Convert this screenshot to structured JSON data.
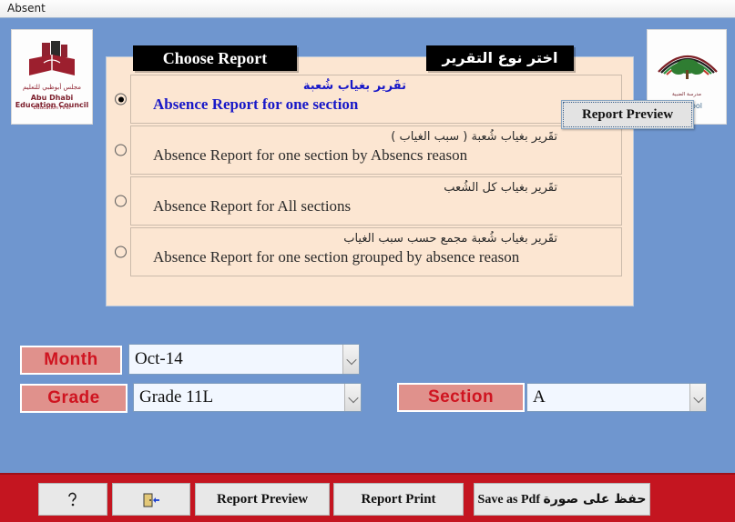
{
  "window": {
    "title": "Absent"
  },
  "theme": {
    "background": "#6f96cf",
    "panel": "#fce6d2",
    "toolbar": "#c41520",
    "label_bg": "#e0918c",
    "label_text": "#cf1420",
    "selected_option": "#1818c8"
  },
  "logos": {
    "left": {
      "name": "adec-logo",
      "line_ar": "مجلس أبوظبي للتعليم",
      "line_en": "Abu Dhabi Education Council",
      "tagline_en": "Education First",
      "tagline_ar": "التعليم أولاً"
    },
    "right": {
      "name": "school-logo",
      "line_ar": "مدرسة الضبية",
      "line_en": "a School"
    }
  },
  "report_panel": {
    "banner_en": "Choose Report",
    "banner_ar": "اختر نوع التقرير",
    "options": [
      {
        "ar": "تقَرير بغياب شُعبة",
        "en": "Absence Report for one section",
        "selected": true
      },
      {
        "ar": "تقَرير بغياب شُعبة ( سبب الغياب )",
        "en": "Absence Report for one section by Absencs reason",
        "selected": false
      },
      {
        "ar": "تقَرير بغياب كل الشُعب",
        "en": "Absence Report for All sections",
        "selected": false
      },
      {
        "ar": "تقَرير بغياب شُعبة مجمع حسب سبب الغياب",
        "en": "Absence Report for one section grouped by absence reason",
        "selected": false
      }
    ],
    "floating_preview_button": "Report Preview"
  },
  "filters": {
    "month": {
      "label": "Month",
      "value": "Oct-14"
    },
    "grade": {
      "label": "Grade",
      "value": "Grade 11L"
    },
    "section": {
      "label": "Section",
      "value": "A"
    }
  },
  "toolbar": {
    "help_icon": "question-mark-help-icon",
    "help_glyph": "❓",
    "exit_icon": "exit-door-icon",
    "exit_glyph": "⎗",
    "report_preview": "Report Preview",
    "report_print": "Report Print",
    "save_pdf_en": "Save as Pdf",
    "save_pdf_ar": "حفظ على صورة"
  }
}
